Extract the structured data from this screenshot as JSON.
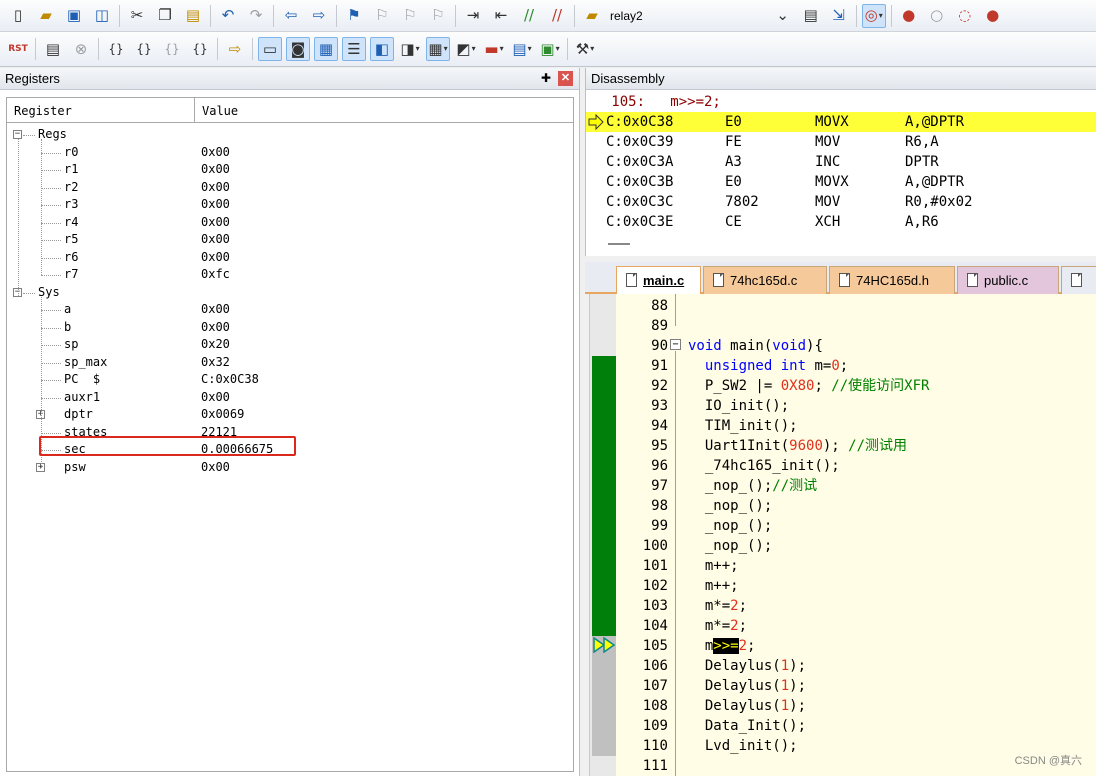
{
  "toolbar1": {
    "buttons": [
      "new-file-icon",
      "open-file-icon",
      "save-icon",
      "save-all-icon",
      "cut-icon",
      "copy-icon",
      "paste-icon",
      "undo-icon",
      "redo-icon",
      "nav-back-icon",
      "nav-forward-icon",
      "bookmark-icon",
      "prev-bookmark-icon",
      "next-bookmark-icon",
      "clear-bookmarks-icon",
      "indent-icon",
      "unindent-icon",
      "comment-icon",
      "uncomment-icon",
      "find-in-files-icon"
    ],
    "target_name": "relay2"
  },
  "registers_panel": {
    "title": "Registers",
    "columns": {
      "register": "Register",
      "value": "Value"
    },
    "groups": [
      {
        "name": "Regs",
        "items": [
          {
            "name": "r0",
            "value": "0x00"
          },
          {
            "name": "r1",
            "value": "0x00"
          },
          {
            "name": "r2",
            "value": "0x00"
          },
          {
            "name": "r3",
            "value": "0x00"
          },
          {
            "name": "r4",
            "value": "0x00"
          },
          {
            "name": "r5",
            "value": "0x00"
          },
          {
            "name": "r6",
            "value": "0x00"
          },
          {
            "name": "r7",
            "value": "0xfc"
          }
        ]
      },
      {
        "name": "Sys",
        "items": [
          {
            "name": "a",
            "value": "0x00"
          },
          {
            "name": "b",
            "value": "0x00"
          },
          {
            "name": "sp",
            "value": "0x20"
          },
          {
            "name": "sp_max",
            "value": "0x32"
          },
          {
            "name": "PC  $",
            "value": "C:0x0C38"
          },
          {
            "name": "auxr1",
            "value": "0x00"
          },
          {
            "name": "dptr",
            "value": "0x0069"
          },
          {
            "name": "states",
            "value": "22121"
          },
          {
            "name": "sec",
            "value": "0.00066675"
          },
          {
            "name": "psw",
            "value": "0x00"
          }
        ]
      }
    ]
  },
  "disassembly": {
    "title": "Disassembly",
    "source_line": "   105:   m>>=2;",
    "lines": [
      {
        "addr": "C:0x0C38",
        "bytes": "E0",
        "mnemonic": "MOVX",
        "operands": "A,@DPTR",
        "current": true
      },
      {
        "addr": "C:0x0C39",
        "bytes": "FE",
        "mnemonic": "MOV",
        "operands": "R6,A",
        "current": false
      },
      {
        "addr": "C:0x0C3A",
        "bytes": "A3",
        "mnemonic": "INC",
        "operands": "DPTR",
        "current": false
      },
      {
        "addr": "C:0x0C3B",
        "bytes": "E0",
        "mnemonic": "MOVX",
        "operands": "A,@DPTR",
        "current": false
      },
      {
        "addr": "C:0x0C3C",
        "bytes": "7802",
        "mnemonic": "MOV",
        "operands": "R0,#0x02",
        "current": false
      },
      {
        "addr": "C:0x0C3E",
        "bytes": "CE",
        "mnemonic": "XCH",
        "operands": "A,R6",
        "current": false
      }
    ]
  },
  "editor": {
    "tabs": [
      {
        "label": "main.c",
        "active": true,
        "color": "#ffffff"
      },
      {
        "label": "74hc165d.c",
        "active": false,
        "color": "#f6c99a"
      },
      {
        "label": "74HC165d.h",
        "active": false,
        "color": "#f6c99a"
      },
      {
        "label": "public.c",
        "active": false,
        "color": "#e3c6dc"
      },
      {
        "label": "",
        "active": false,
        "color": "#e8ecf2"
      }
    ],
    "lines": [
      {
        "n": "88",
        "cov": "none",
        "html": ""
      },
      {
        "n": "89",
        "cov": "none",
        "html": ""
      },
      {
        "n": "90",
        "cov": "none",
        "html": "<span class='kw'>void</span> main(<span class='kw'>void</span>){"
      },
      {
        "n": "91",
        "cov": "green",
        "html": "  <span class='kw'>unsigned</span> <span class='kw'>int</span> m=<span class='num'>0</span>;"
      },
      {
        "n": "92",
        "cov": "green",
        "html": "  P_SW2 |= <span class='num'>0X80</span>; <span class='cm'>//使能访问XFR</span>"
      },
      {
        "n": "93",
        "cov": "green",
        "html": "  IO_init();"
      },
      {
        "n": "94",
        "cov": "green",
        "html": "  TIM_init();"
      },
      {
        "n": "95",
        "cov": "green",
        "html": "  Uart1Init(<span class='num'>9600</span>); <span class='cm'>//测试用</span>"
      },
      {
        "n": "96",
        "cov": "green",
        "html": "  _74hc165_init();"
      },
      {
        "n": "97",
        "cov": "green",
        "html": "  _nop_();<span class='cm'>//测试</span>"
      },
      {
        "n": "98",
        "cov": "green",
        "html": "  _nop_();"
      },
      {
        "n": "99",
        "cov": "green",
        "html": "  _nop_();"
      },
      {
        "n": "100",
        "cov": "green",
        "html": "  _nop_();"
      },
      {
        "n": "101",
        "cov": "green",
        "html": "  m++;"
      },
      {
        "n": "102",
        "cov": "green",
        "html": "  m++;"
      },
      {
        "n": "103",
        "cov": "green",
        "html": "  m*=<span class='num'>2</span>;"
      },
      {
        "n": "104",
        "cov": "green",
        "html": "  m*=<span class='num'>2</span>;"
      },
      {
        "n": "105",
        "cov": "grey",
        "html": "  m<span class='hlop'>&gt;&gt;=</span><span class='num'>2</span>;"
      },
      {
        "n": "106",
        "cov": "grey",
        "html": "  Delaylus(<span class='num'>1</span>);"
      },
      {
        "n": "107",
        "cov": "grey",
        "html": "  Delaylus(<span class='num'>1</span>);"
      },
      {
        "n": "108",
        "cov": "grey",
        "html": "  Delaylus(<span class='num'>1</span>);"
      },
      {
        "n": "109",
        "cov": "grey",
        "html": "  Data_Init();"
      },
      {
        "n": "110",
        "cov": "grey",
        "html": "  Lvd_init();"
      },
      {
        "n": "111",
        "cov": "none",
        "html": ""
      }
    ]
  },
  "watermark": "CSDN @真六",
  "colors": {
    "coverage_green": "#00800a",
    "current_line": "#ffff38",
    "highlight_box": "#d9291c"
  }
}
